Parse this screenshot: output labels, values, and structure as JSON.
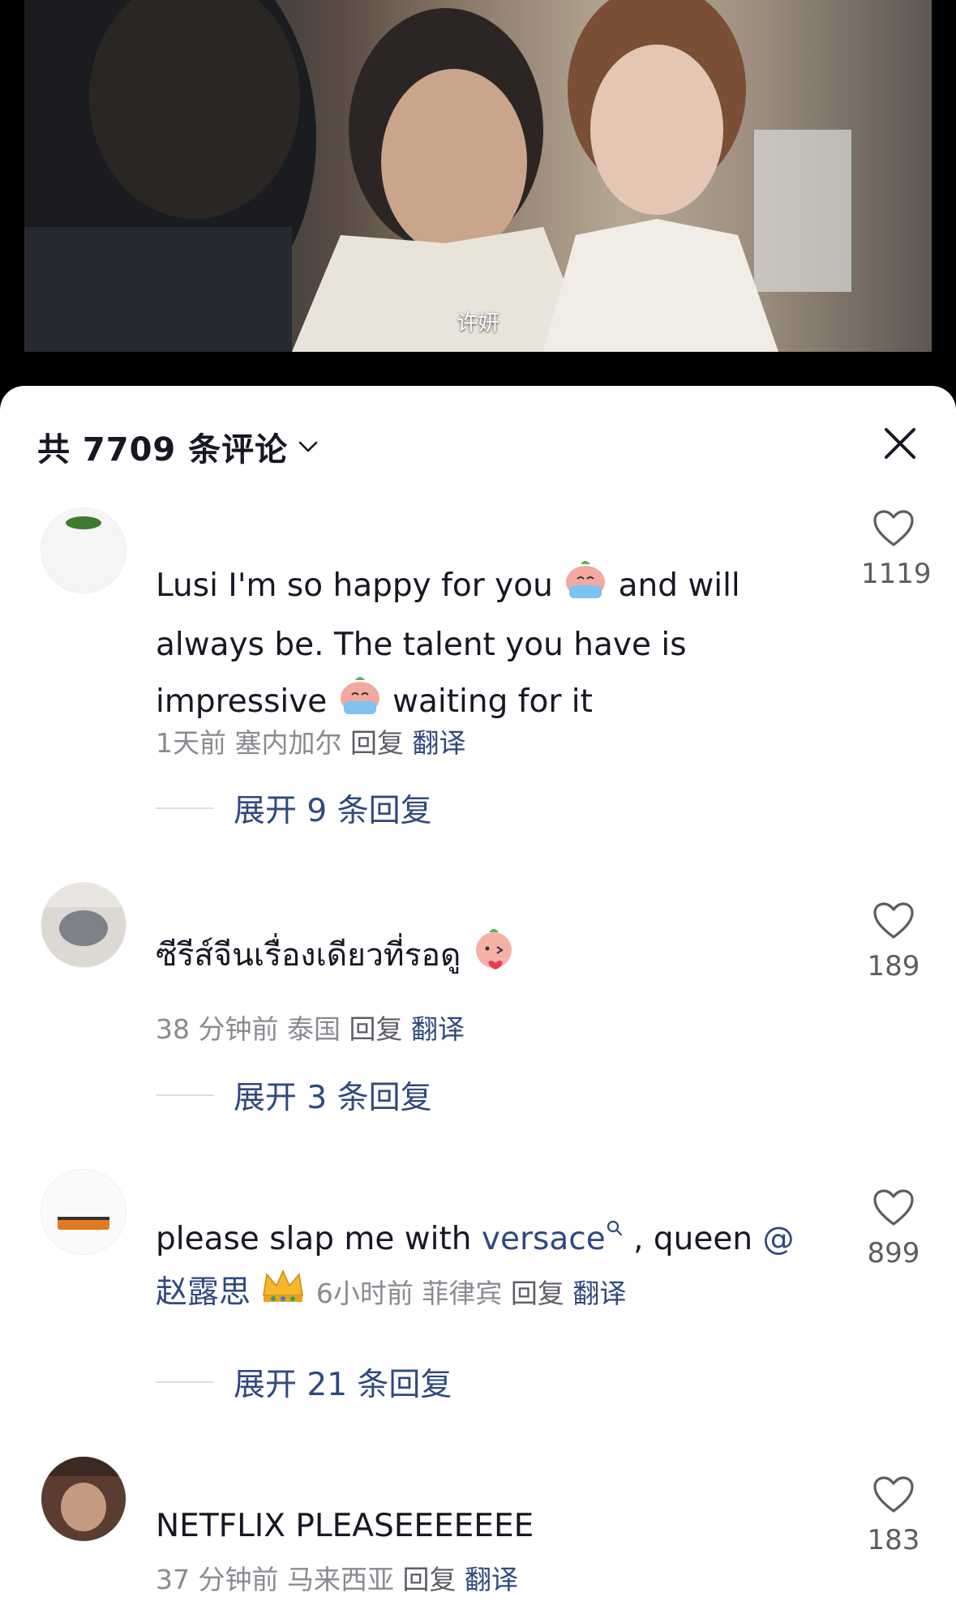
{
  "video": {
    "subtitle": "许妍"
  },
  "comments_panel": {
    "title": "共 7709 条评论",
    "close_icon": "close-icon",
    "comments": [
      {
        "text_parts": [
          "Lusi I'm so happy for you ",
          " and will always be. The talent you have is impressive  ",
          " waiting for it"
        ],
        "emojis": [
          "crying-emoji",
          "crying-emoji"
        ],
        "time": "1天前",
        "location": "塞内加尔",
        "reply_label": "回复",
        "translate_label": "翻译",
        "likes": "1119",
        "expand_label": "展开 9 条回复"
      },
      {
        "text": "ซีรีส์จีนเรื่องเดียวที่รอดู",
        "emoji": "kiss-heart-emoji",
        "time": "38 分钟前",
        "location": "泰国",
        "reply_label": "回复",
        "translate_label": "翻译",
        "likes": "189",
        "expand_label": "展开 3 条回复"
      },
      {
        "text_prefix": "please slap me with ",
        "search_link": "versace",
        "text_mid": " , queen ",
        "mention": "@赵露思",
        "emoji": "crown-emoji",
        "time": "6小时前",
        "location": "菲律宾",
        "reply_label": "回复",
        "translate_label": "翻译",
        "likes": "899",
        "expand_label": "展开 21 条回复"
      },
      {
        "text": "NETFLIX  PLEASEEEEEEE",
        "time": "37 分钟前",
        "location": "马来西亚",
        "reply_label": "回复",
        "translate_label": "翻译",
        "likes": "183"
      }
    ]
  },
  "colors": {
    "link": "#2f4a7e",
    "meta": "#8a8b91",
    "text": "#161823"
  }
}
